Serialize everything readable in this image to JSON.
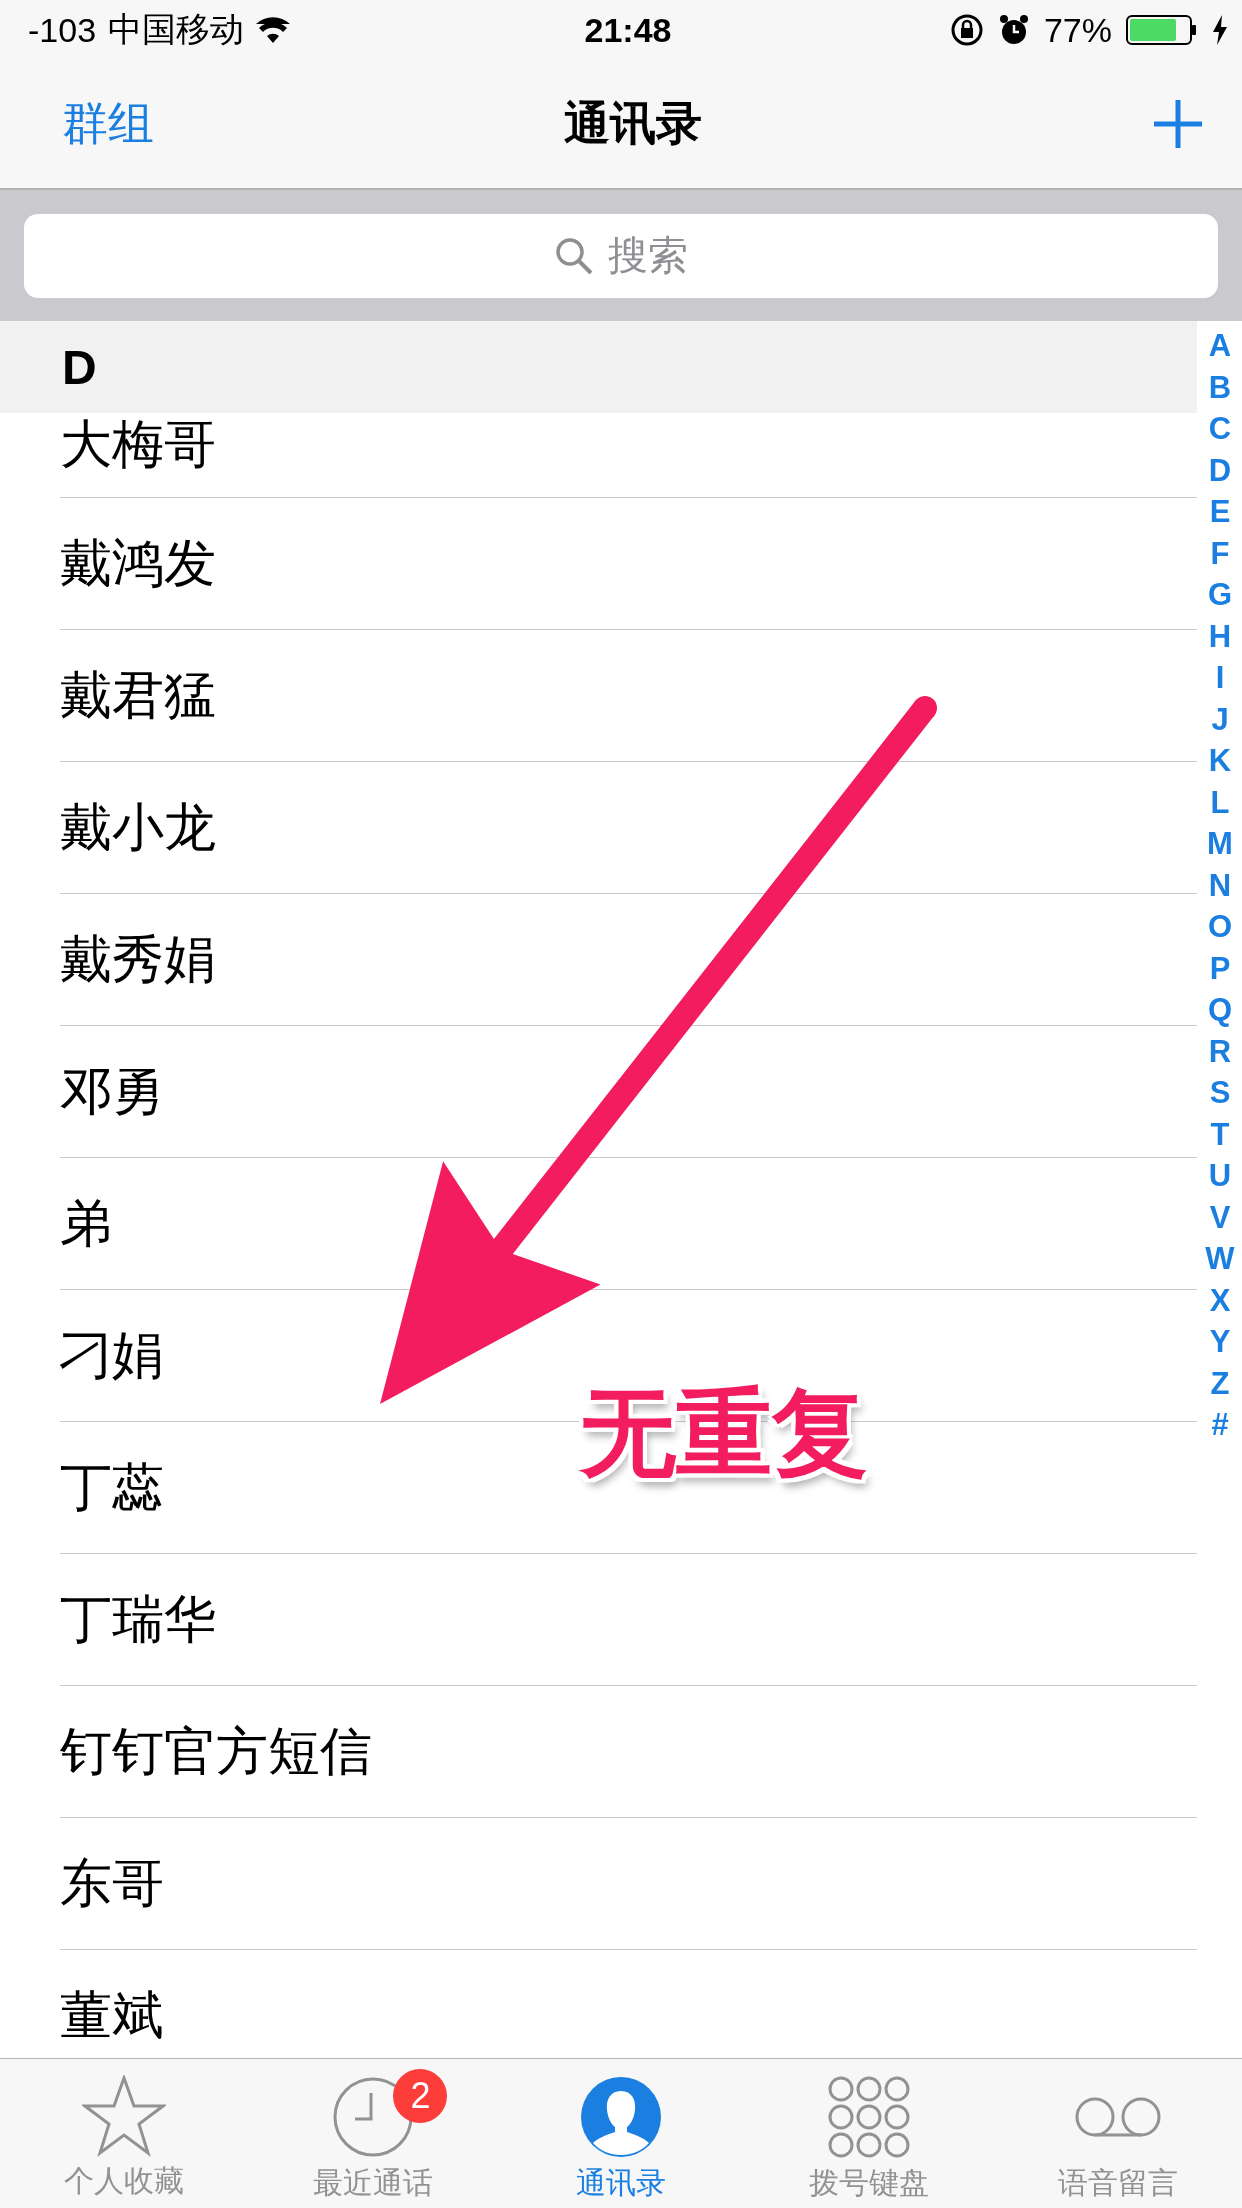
{
  "status_bar": {
    "signal": "-103",
    "carrier": "中国移动",
    "time": "21:48",
    "battery_percent": "77%"
  },
  "nav_bar": {
    "left_button": "群组",
    "title": "通讯录"
  },
  "search": {
    "placeholder": "搜索"
  },
  "section": {
    "header": "D"
  },
  "contacts": [
    {
      "name": "大梅哥"
    },
    {
      "name": "戴鸿发"
    },
    {
      "name": "戴君猛"
    },
    {
      "name": "戴小龙"
    },
    {
      "name": "戴秀娟"
    },
    {
      "name": "邓勇"
    },
    {
      "name": "弟"
    },
    {
      "name": "刁娟"
    },
    {
      "name": "丁蕊"
    },
    {
      "name": "丁瑞华"
    },
    {
      "name": "钉钉官方短信"
    },
    {
      "name": "东哥"
    },
    {
      "name": "董斌"
    }
  ],
  "index": [
    "A",
    "B",
    "C",
    "D",
    "E",
    "F",
    "G",
    "H",
    "I",
    "J",
    "K",
    "L",
    "M",
    "N",
    "O",
    "P",
    "Q",
    "R",
    "S",
    "T",
    "U",
    "V",
    "W",
    "X",
    "Y",
    "Z",
    "#"
  ],
  "annotation": {
    "text": "无重复"
  },
  "tab_bar": [
    {
      "label": "个人收藏",
      "kind": "star",
      "selected": false
    },
    {
      "label": "最近通话",
      "kind": "clock",
      "selected": false,
      "badge": "2"
    },
    {
      "label": "通讯录",
      "kind": "contact",
      "selected": true
    },
    {
      "label": "拨号键盘",
      "kind": "keypad",
      "selected": false
    },
    {
      "label": "语音留言",
      "kind": "voicemail",
      "selected": false
    }
  ]
}
